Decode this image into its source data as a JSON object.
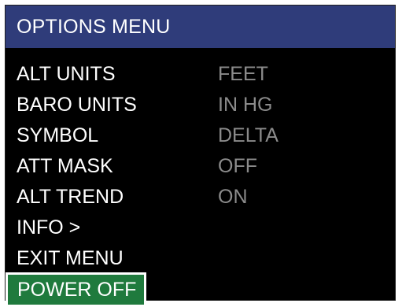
{
  "title": "OPTIONS MENU",
  "menu": [
    {
      "label": "ALT UNITS",
      "value": "FEET"
    },
    {
      "label": "BARO UNITS",
      "value": "IN HG"
    },
    {
      "label": "SYMBOL",
      "value": "DELTA"
    },
    {
      "label": "ATT MASK",
      "value": "OFF"
    },
    {
      "label": "ALT TREND",
      "value": "ON"
    },
    {
      "label": "INFO >",
      "value": ""
    },
    {
      "label": "EXIT MENU",
      "value": ""
    },
    {
      "label": "POWER OFF",
      "value": ""
    }
  ],
  "colors": {
    "title_bar": "#2f3c7a",
    "background": "#000000",
    "label_text": "#ffffff",
    "value_text": "#8b8b8b",
    "selection": "#1f7a3d"
  }
}
